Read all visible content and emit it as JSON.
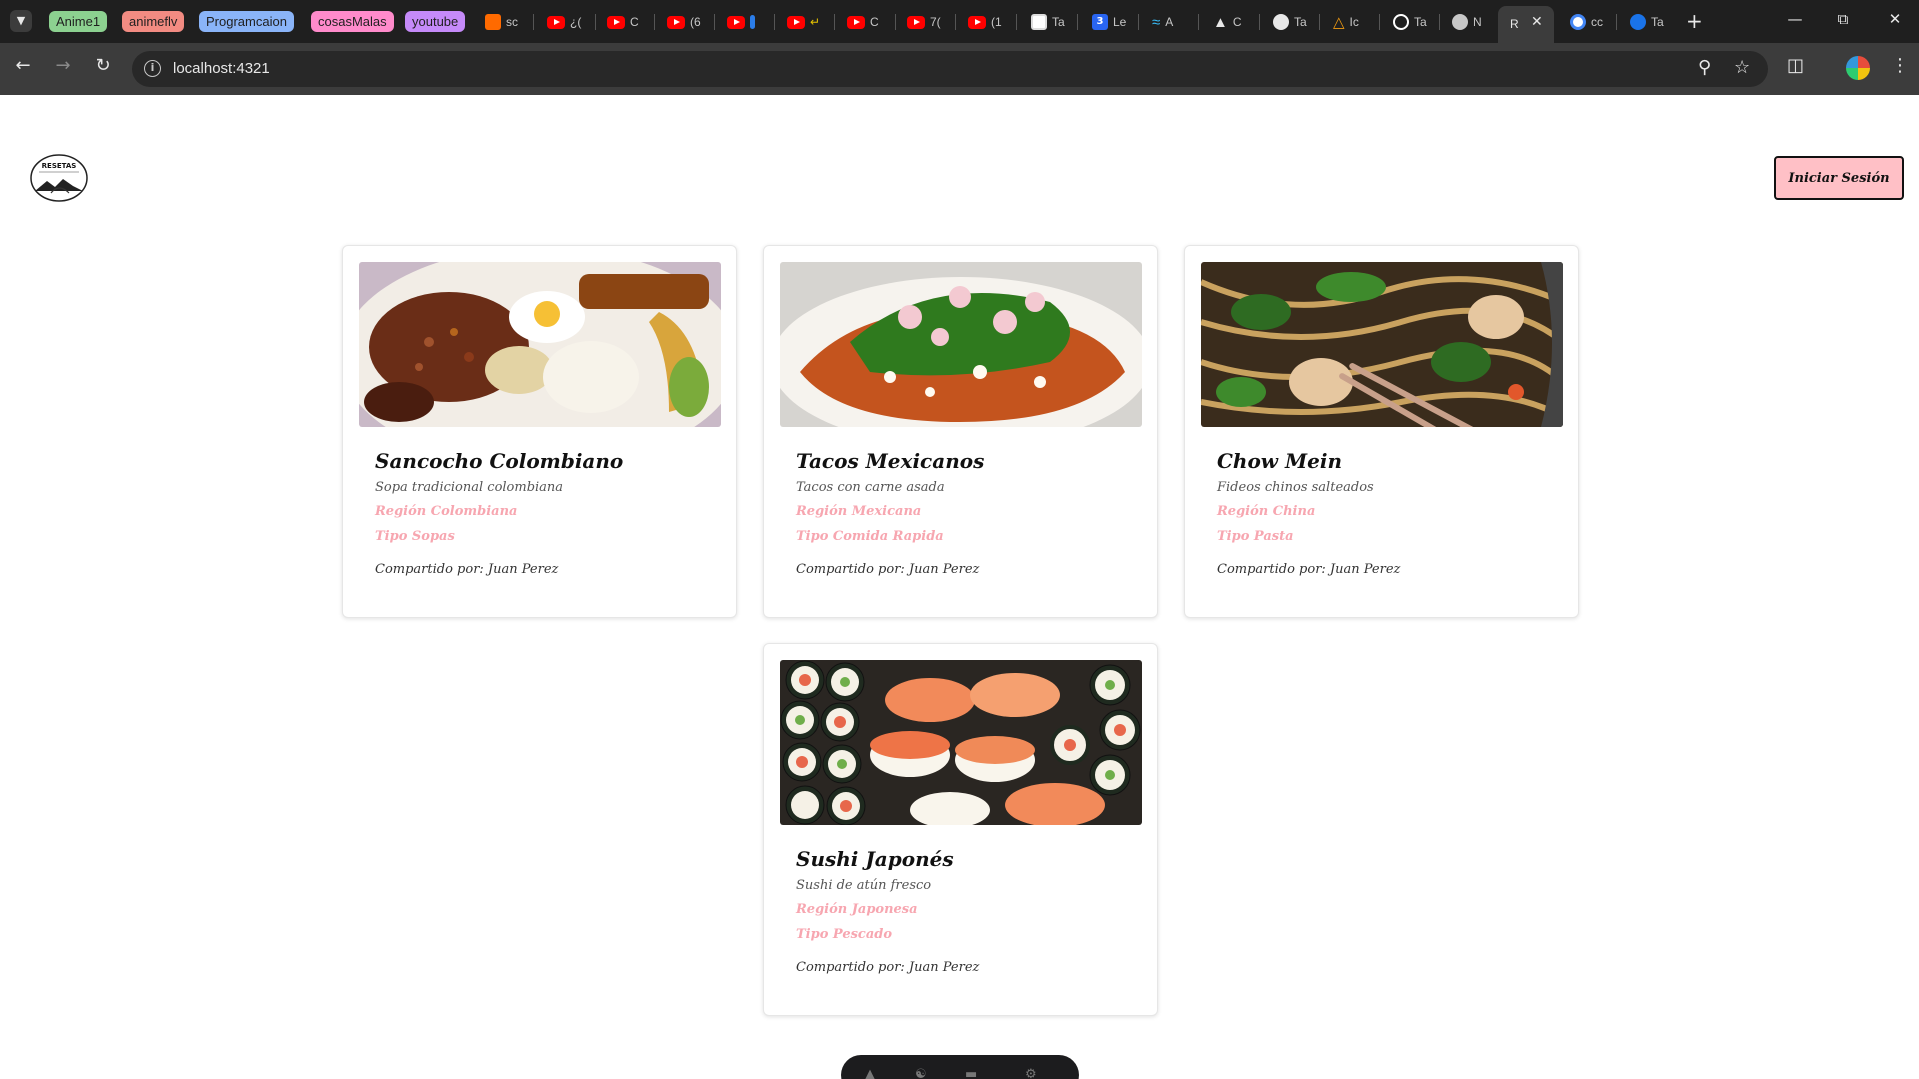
{
  "browser": {
    "tab_groups": [
      {
        "label": "Anime1",
        "color": "#8cd190"
      },
      {
        "label": "animeflv",
        "color": "#f28b82"
      },
      {
        "label": "Programcaion",
        "color": "#8ab4f8"
      },
      {
        "label": "cosasMalas",
        "color": "#ff8bcb"
      },
      {
        "label": "youtube",
        "color": "#c58af9"
      }
    ],
    "tabs": [
      {
        "label": "sc",
        "icon": "w-icon",
        "color": "#ff6a00"
      },
      {
        "label": "¿(",
        "icon": "youtube-icon",
        "color": "#ff0000"
      },
      {
        "label": "C",
        "icon": "youtube-icon",
        "color": "#ff0000"
      },
      {
        "label": "(6",
        "icon": "youtube-icon",
        "color": "#ff0000"
      },
      {
        "label": "",
        "icon": "youtube-icon",
        "color": "#ff0000"
      },
      {
        "label": "",
        "icon": "youtube-icon",
        "color": "#ff0000"
      },
      {
        "label": "C",
        "icon": "youtube-icon",
        "color": "#ff0000"
      },
      {
        "label": "7(",
        "icon": "youtube-icon",
        "color": "#ff0000"
      },
      {
        "label": "(1",
        "icon": "youtube-icon",
        "color": "#ff0000"
      },
      {
        "label": "Ta",
        "icon": "page-icon",
        "color": "#ffffff"
      },
      {
        "label": "Le",
        "icon": "css-icon",
        "color": "#2965f1"
      },
      {
        "label": "A",
        "icon": "tailwind-icon",
        "color": "#38bdf8"
      },
      {
        "label": "C",
        "icon": "astro-icon",
        "color": "#e8e8e8"
      },
      {
        "label": "Ta",
        "icon": "github-icon",
        "color": "#e8e8e8"
      },
      {
        "label": "Ic",
        "icon": "triangle-icon",
        "color": "#f39c12"
      },
      {
        "label": "Ta",
        "icon": "openai-icon",
        "color": "#ffffff"
      },
      {
        "label": "N",
        "icon": "globe-icon",
        "color": "#c7c7c7"
      }
    ],
    "active_tab": {
      "label": "R",
      "close": "✕"
    },
    "after_tabs": [
      {
        "label": "cc",
        "icon": "google-icon",
        "color": "#4285f4"
      },
      {
        "label": "Ta",
        "icon": "blue-circle-icon",
        "color": "#1a73e8"
      }
    ],
    "url": "localhost:4321"
  },
  "header": {
    "logo_text": "RESETAS",
    "login_label": "Iniciar Sesión"
  },
  "recipes": [
    {
      "title": "Sancocho Colombiano",
      "description": "Sopa tradicional colombiana",
      "region": "Región Colombiana",
      "type": "Tipo Sopas",
      "author": "Compartido por: Juan Perez",
      "image": "sancocho-image"
    },
    {
      "title": "Tacos Mexicanos",
      "description": "Tacos con carne asada",
      "region": "Región Mexicana",
      "type": "Tipo Comida Rapida",
      "author": "Compartido por: Juan Perez",
      "image": "tacos-image"
    },
    {
      "title": "Chow Mein",
      "description": "Fideos chinos salteados",
      "region": "Región China",
      "type": "Tipo Pasta",
      "author": "Compartido por: Juan Perez",
      "image": "chow-mein-image"
    },
    {
      "title": "Sushi Japonés",
      "description": "Sushi de atún fresco",
      "region": "Región Japonesa",
      "type": "Tipo Pescado",
      "author": "Compartido por: Juan Perez",
      "image": "sushi-image"
    }
  ],
  "colors": {
    "accent": "#ffc0c6",
    "meta_text": "#f7a6b0"
  }
}
